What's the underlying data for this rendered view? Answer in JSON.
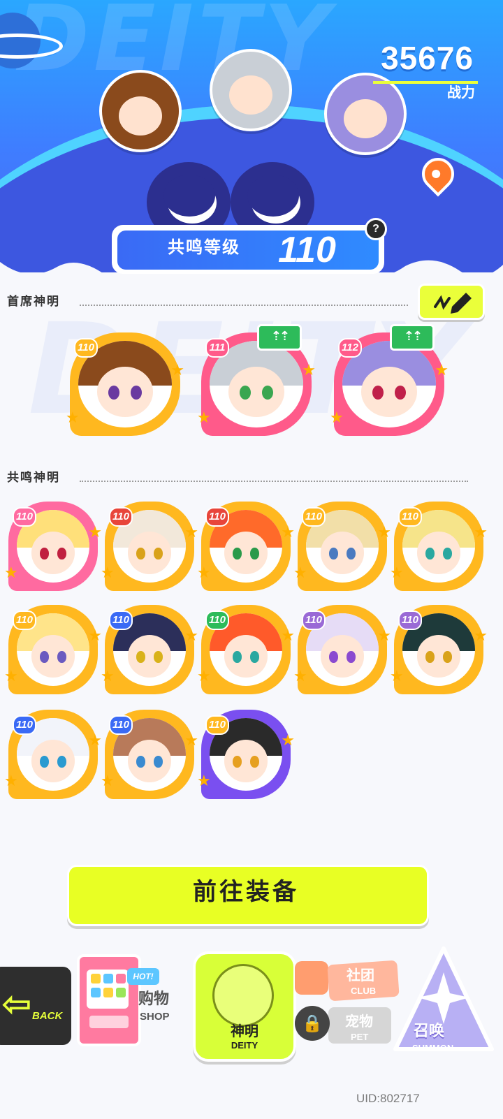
{
  "header": {
    "power_value": "35676",
    "power_label": "战力",
    "watermark": "DEITY"
  },
  "resonance": {
    "label": "共鸣等级",
    "level": "110",
    "help": "?"
  },
  "chief": {
    "title": "首席神明",
    "edit_icon": "pencil-icon",
    "cards": [
      {
        "level": "110",
        "frame": "#ffb81f",
        "hair": "#8a4a1c",
        "eye": "#6a3aa0",
        "upgrade": false
      },
      {
        "level": "111",
        "frame": "#ff5a8a",
        "hair": "#c9cfd6",
        "eye": "#3aa650",
        "upgrade": true
      },
      {
        "level": "112",
        "frame": "#ff5a8a",
        "hair": "#9a8ee0",
        "eye": "#c0204a",
        "upgrade": true
      }
    ],
    "upgrade_glyph": "⇡⇡"
  },
  "resonant": {
    "title": "共鸣神明",
    "cards": [
      {
        "level": "110",
        "frame": "#ff6aa0",
        "badge": "#ff6aa0",
        "hair": "#ffe07a",
        "eye": "#c02040"
      },
      {
        "level": "110",
        "frame": "#ffb81f",
        "badge": "#e8453a",
        "hair": "#f2e8da",
        "eye": "#d9a21a"
      },
      {
        "level": "110",
        "frame": "#ffb81f",
        "badge": "#e8453a",
        "hair": "#ff6a2a",
        "eye": "#2a9a4a"
      },
      {
        "level": "110",
        "frame": "#ffb81f",
        "badge": "#ffb81f",
        "hair": "#f2dfa8",
        "eye": "#4a7ac0"
      },
      {
        "level": "110",
        "frame": "#ffb81f",
        "badge": "#ffb81f",
        "hair": "#f6e48a",
        "eye": "#2aa8a0"
      },
      {
        "level": "110",
        "frame": "#ffb81f",
        "badge": "#ffb81f",
        "hair": "#ffe48a",
        "eye": "#6a5ac0"
      },
      {
        "level": "110",
        "frame": "#ffb81f",
        "badge": "#3a6af5",
        "hair": "#2c2f5a",
        "eye": "#d9b21a"
      },
      {
        "level": "110",
        "frame": "#ffb81f",
        "badge": "#2dbb5a",
        "hair": "#ff5a2a",
        "eye": "#2aa8a0"
      },
      {
        "level": "110",
        "frame": "#ffb81f",
        "badge": "#9a6ad6",
        "hair": "#e6dcf6",
        "eye": "#8a4ad0"
      },
      {
        "level": "110",
        "frame": "#ffb81f",
        "badge": "#9a6ad6",
        "hair": "#1e3a3a",
        "eye": "#d9a21a"
      },
      {
        "level": "110",
        "frame": "#ffb81f",
        "badge": "#3a6af5",
        "hair": "#f2f4fa",
        "eye": "#2a9ad0"
      },
      {
        "level": "110",
        "frame": "#ffb81f",
        "badge": "#3a6af5",
        "hair": "#b87a5a",
        "eye": "#3a8ad0"
      },
      {
        "level": "110",
        "frame": "#7a4ff0",
        "badge": "#ffb81f",
        "hair": "#2a2a2a",
        "eye": "#e6a020"
      }
    ]
  },
  "equip_button": "前往装备",
  "nav": {
    "back": "BACK",
    "shop": "购物",
    "shop_sub": "SHOP",
    "hot": "HOT!",
    "deity": "神明",
    "deity_sub": "DEITY",
    "club": "社团",
    "club_sub": "CLUB",
    "pet": "宠物",
    "pet_sub": "PET",
    "summon": "召唤",
    "summon_sub": "SUMMON"
  },
  "uid": "UID:802717",
  "colors": {
    "accent_yellow": "#e8ff24",
    "banner_blue": "#3f7dff",
    "gold_frame": "#ffb81f"
  }
}
